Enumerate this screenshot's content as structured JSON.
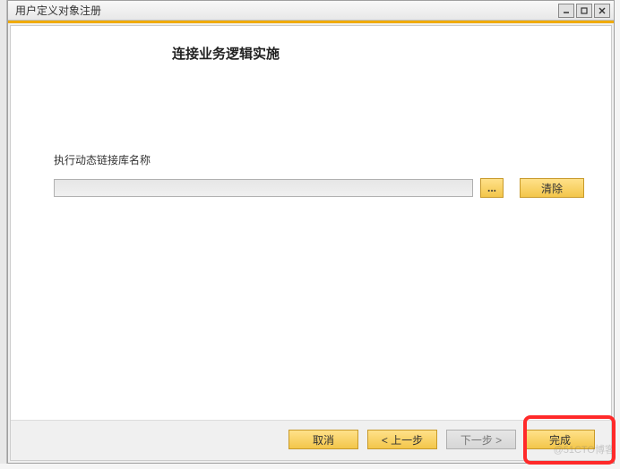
{
  "window": {
    "title": "用户定义对象注册"
  },
  "page": {
    "heading": "连接业务逻辑实施"
  },
  "form": {
    "dll_label": "执行动态链接库名称",
    "dll_value": "",
    "browse_label": "...",
    "clear_label": "清除"
  },
  "footer": {
    "cancel": "取消",
    "back": "< 上一步",
    "next": "下一步 >",
    "finish": "完成"
  },
  "watermark": "@51CTO博客"
}
